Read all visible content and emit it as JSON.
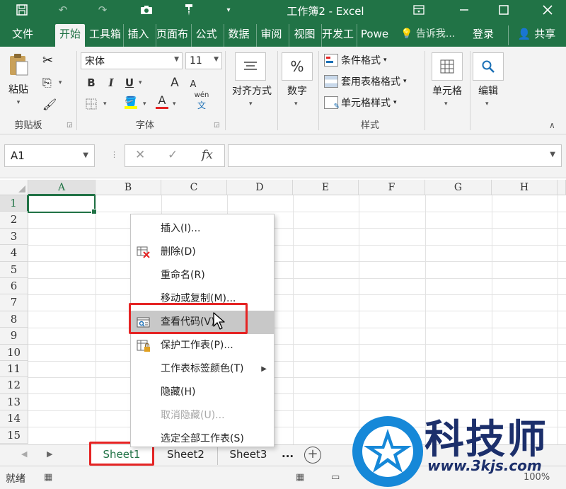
{
  "window": {
    "title": "工作簿2 - Excel",
    "colors": {
      "brand": "#217346",
      "highlight": "#e52424",
      "watermark": "#1c2f6b"
    },
    "quick_access": [
      "save-icon",
      "undo-icon",
      "redo-icon",
      "camera-icon",
      "brush-icon",
      "more-icon"
    ],
    "controls": [
      "ribbon-display-icon",
      "minimize-icon",
      "restore-icon",
      "close-icon"
    ]
  },
  "ribbon_tabs": [
    "文件",
    "开始",
    "工具箱",
    "插入",
    "页面布",
    "公式",
    "数据",
    "审阅",
    "视图",
    "开发工",
    "Powe"
  ],
  "active_tab": "开始",
  "tell_me": "告诉我...",
  "login": "登录",
  "share": "共享",
  "clipboard": {
    "paste": "粘贴",
    "label": "剪贴板"
  },
  "font": {
    "name": "宋体",
    "size": "11",
    "label": "字体",
    "bold": "B",
    "italic": "I",
    "underline": "U",
    "grow": "A",
    "shrink": "A",
    "font_color": "A",
    "phonetic": "wén"
  },
  "alignment": {
    "label": "对齐方式"
  },
  "number": {
    "symbol": "%",
    "label": "数字"
  },
  "styles": {
    "conditional": "条件格式",
    "table": "套用表格格式",
    "cell": "单元格样式",
    "label": "样式"
  },
  "cells": {
    "label": "单元格"
  },
  "editing": {
    "label": "编辑"
  },
  "formula_bar": {
    "name_box": "A1",
    "cancel": "✕",
    "enter": "✓",
    "fx": "fx",
    "value": ""
  },
  "columns": [
    "A",
    "B",
    "C",
    "D",
    "E",
    "F",
    "G",
    "H"
  ],
  "rows": [
    "1",
    "2",
    "3",
    "4",
    "5",
    "6",
    "7",
    "8",
    "9",
    "10",
    "11",
    "12",
    "13",
    "14",
    "15"
  ],
  "active_cell": "A1",
  "context_menu": [
    {
      "label": "插入(I)...",
      "icon": "",
      "disabled": false
    },
    {
      "label": "删除(D)",
      "icon": "delete-sheet-icon",
      "disabled": false
    },
    {
      "label": "重命名(R)",
      "icon": "",
      "disabled": false
    },
    {
      "label": "移动或复制(M)...",
      "icon": "",
      "disabled": false
    },
    {
      "label": "查看代码(V)",
      "icon": "view-code-icon",
      "disabled": false,
      "highlighted": true
    },
    {
      "label": "保护工作表(P)...",
      "icon": "protect-sheet-icon",
      "disabled": false
    },
    {
      "label": "工作表标签颜色(T)",
      "icon": "",
      "disabled": false,
      "submenu": true
    },
    {
      "label": "隐藏(H)",
      "icon": "",
      "disabled": false
    },
    {
      "label": "取消隐藏(U)...",
      "icon": "",
      "disabled": true
    },
    {
      "label": "选定全部工作表(S)",
      "icon": "",
      "disabled": false
    }
  ],
  "sheets": [
    "Sheet1",
    "Sheet2",
    "Sheet3"
  ],
  "active_sheet": "Sheet1",
  "sheet_more": "...",
  "status": {
    "text": "就绪",
    "zoom": "100%"
  },
  "watermark": {
    "title": "科技师",
    "url": "www.3kjs.com"
  }
}
